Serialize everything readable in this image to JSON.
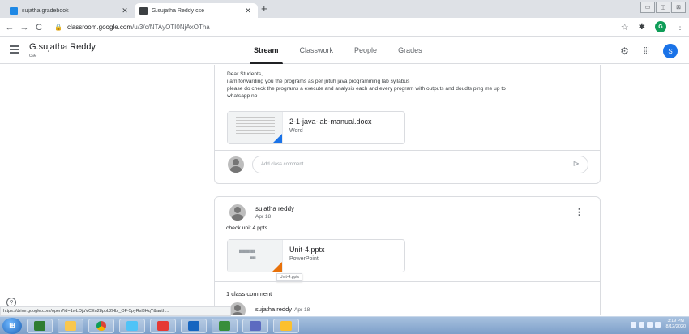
{
  "browser": {
    "tabs": [
      {
        "title": "sujatha gradebook"
      },
      {
        "title": "G.sujatha Reddy cse"
      }
    ],
    "new_tab_label": "+",
    "nav": {
      "back": "←",
      "forward": "→",
      "reload": "C"
    },
    "url_domain": "classroom.google.com",
    "url_path": "/u/3/c/NTAyOTI0NjAxOTha",
    "profile_initial": "G",
    "star": "☆"
  },
  "header": {
    "class_name": "G.sujatha Reddy",
    "class_section": "cse",
    "tabs": [
      "Stream",
      "Classwork",
      "People",
      "Grades"
    ],
    "user_initial": "S"
  },
  "post1": {
    "lines": [
      "Dear Students,",
      "i am forwarding you the programs as  per jntuh java programming lab syllabus",
      "please do check the programs a execute and analysis each and every program with outputs and doudts ping me up to",
      "whatsapp no"
    ],
    "attachment": {
      "name": "2-1-java-lab-manual.docx",
      "type": "Word"
    },
    "comment_placeholder": "Add class comment..."
  },
  "post2": {
    "author": "sujatha reddy",
    "date": "Apr 18",
    "body": "check unit 4 ppts",
    "attachment": {
      "name": "Unit-4.pptx",
      "type": "PowerPoint",
      "tooltip": "Unit-4.pptx"
    },
    "comments_count": "1 class comment",
    "commenter": "sujatha reddy",
    "comment_date": "Apr 18"
  },
  "status_url": "https://drive.google.com/open?id=1wLOjuVCEn28pob2Hbl_OF-5pyRsl3HqY&auth...",
  "taskbar": {
    "time": "3:19 PM",
    "date": "8/12/2020"
  }
}
